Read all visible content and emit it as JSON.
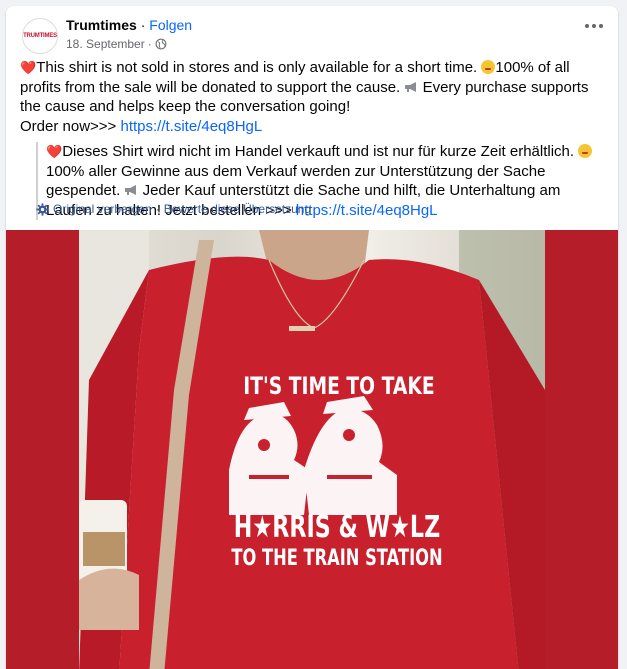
{
  "post": {
    "page_name": "Trumtimes",
    "separator": " · ",
    "follow_label": "Folgen",
    "date": "18. September",
    "date_separator": " · ",
    "avatar_text": "TRUMTIMES",
    "text_line1": "This shirt is not sold in stores and is only available for a short time.",
    "text_line1b": "100% of all profits from the sale will be donated to support the cause.",
    "text_line1c": "Every purchase supports the cause and helps keep the conversation going!",
    "order_prefix": "Order now>>> ",
    "order_link": "https://t.site/4eq8HgL"
  },
  "translation": {
    "part1": "Dieses Shirt wird nicht im Handel verkauft und ist nur für kurze Zeit erhältlich.",
    "part2": "100% aller Gewinne aus dem Verkauf werden zur Unterstützung der Sache gespendet.",
    "part3": "Jeder Kauf unterstützt die Sache und hilft, die Unterhaltung am Laufen zu halten! Jetzt bestellen >>> ",
    "link": "https://t.site/4eq8HgL",
    "hide_original_label": "Original verbergen",
    "meta_separator": " · ",
    "rate_translation_label": "Bewerte diese Übersetzung"
  },
  "image": {
    "shirt_line1": "IT'S TIME TO TAKE",
    "shirt_line2": "H★RRIS & W★LZ",
    "shirt_line3": "TO THE TRAIN STATION",
    "shirt_color": "#c8202d",
    "frame_color": "#b51d28"
  },
  "colors": {
    "link": "#0866ff",
    "meta_text": "#65676b",
    "meta_link": "#385898"
  }
}
